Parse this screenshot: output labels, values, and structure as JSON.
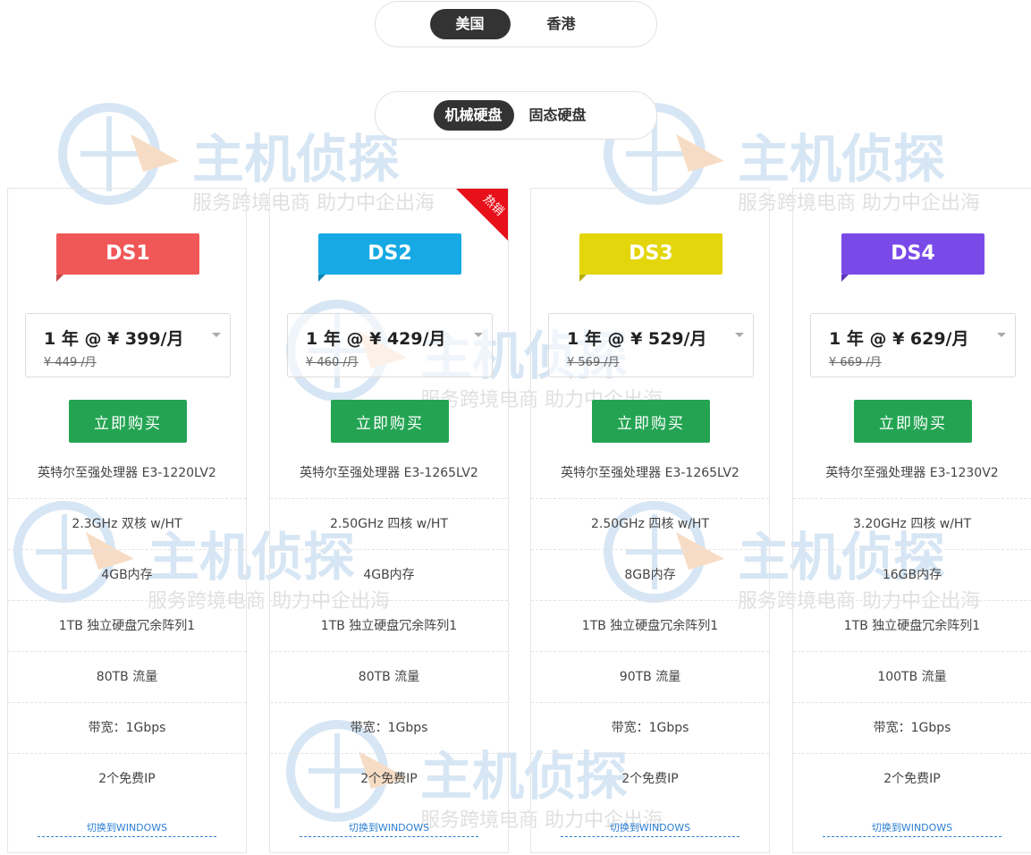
{
  "region_tabs": [
    {
      "label": "美国",
      "active": true
    },
    {
      "label": "香港",
      "active": false
    }
  ],
  "disk_tabs": [
    {
      "label": "机械硬盘",
      "active": true
    },
    {
      "label": "固态硬盘",
      "active": false
    }
  ],
  "watermark": {
    "main": "主机侦探",
    "sub": "服务跨境电商 助力中企出海"
  },
  "colors": {
    "buy_button": "#24a453",
    "hot_badge": "#e8111b",
    "toggle_active": "#333333"
  },
  "plans": [
    {
      "name": "DS1",
      "color": "#f05757",
      "hot": false,
      "price": "1 年 @ ¥ 399/月",
      "old_price": "¥ 449 /月",
      "buy_label": "立即购买",
      "specs": [
        "英特尔至强处理器 E3-1220LV2",
        "2.3GHz 双核 w/HT",
        "4GB内存",
        "1TB 独立硬盘冗余阵列1",
        "80TB 流量",
        "带宽：1Gbps",
        "2个免费IP"
      ],
      "switch_label": "切换到WINDOWS"
    },
    {
      "name": "DS2",
      "color": "#16a9e3",
      "hot": true,
      "hot_label": "热销",
      "price": "1 年 @ ¥ 429/月",
      "old_price": "¥ 460 /月",
      "buy_label": "立即购买",
      "specs": [
        "英特尔至强处理器 E3-1265LV2",
        "2.50GHz 四核 w/HT",
        "4GB内存",
        "1TB 独立硬盘冗余阵列1",
        "80TB 流量",
        "带宽：1Gbps",
        "2个免费IP"
      ],
      "switch_label": "切换到WINDOWS"
    },
    {
      "name": "DS3",
      "color": "#e4d60d",
      "hot": false,
      "price": "1 年 @ ¥ 529/月",
      "old_price": "¥ 569 /月",
      "buy_label": "立即购买",
      "specs": [
        "英特尔至强处理器 E3-1265LV2",
        "2.50GHz 四核 w/HT",
        "8GB内存",
        "1TB 独立硬盘冗余阵列1",
        "90TB 流量",
        "带宽：1Gbps",
        "2个免费IP"
      ],
      "switch_label": "切换到WINDOWS"
    },
    {
      "name": "DS4",
      "color": "#7a4ae9",
      "hot": false,
      "price": "1 年 @ ¥ 629/月",
      "old_price": "¥ 669 /月",
      "buy_label": "立即购买",
      "specs": [
        "英特尔至强处理器 E3-1230V2",
        "3.20GHz 四核 w/HT",
        "16GB内存",
        "1TB 独立硬盘冗余阵列1",
        "100TB 流量",
        "带宽：1Gbps",
        "2个免费IP"
      ],
      "switch_label": "切换到WINDOWS"
    }
  ]
}
